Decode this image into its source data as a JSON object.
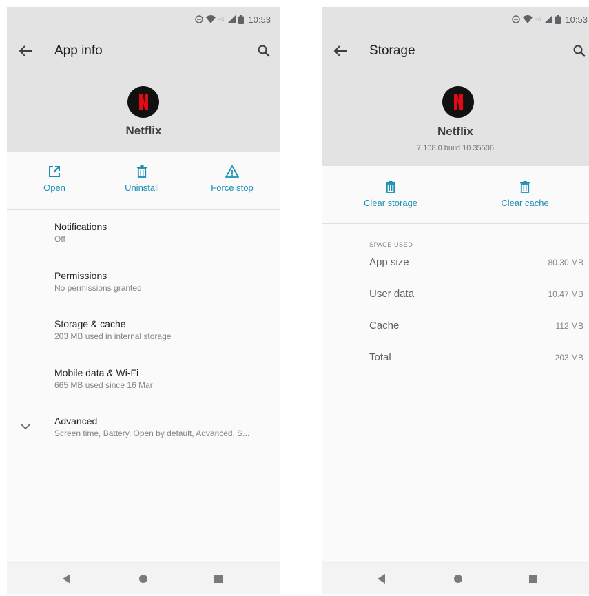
{
  "status_bar": {
    "time": "10:53",
    "icons": [
      "dnd-icon",
      "wifi-icon",
      "4g-icon",
      "signal-icon",
      "battery-icon"
    ]
  },
  "colors": {
    "accent": "#1a8fb4",
    "header_bg": "#e3e3e3",
    "netflix_red": "#e50914"
  },
  "app_info": {
    "title": "App info",
    "app_name": "Netflix",
    "actions": [
      {
        "label": "Open",
        "icon": "open-external-icon"
      },
      {
        "label": "Uninstall",
        "icon": "trash-icon"
      },
      {
        "label": "Force stop",
        "icon": "warning-icon"
      }
    ],
    "items": [
      {
        "title": "Notifications",
        "subtitle": "Off"
      },
      {
        "title": "Permissions",
        "subtitle": "No permissions granted"
      },
      {
        "title": "Storage & cache",
        "subtitle": "203 MB used in internal storage"
      },
      {
        "title": "Mobile data & Wi-Fi",
        "subtitle": "665 MB used since 16 Mar"
      },
      {
        "title": "Advanced",
        "subtitle": "Screen time, Battery, Open by default, Advanced, S..."
      }
    ]
  },
  "storage": {
    "title": "Storage",
    "app_name": "Netflix",
    "version": "7.108.0 build 10 35506",
    "actions": [
      {
        "label": "Clear storage",
        "icon": "trash-icon"
      },
      {
        "label": "Clear cache",
        "icon": "trash-icon"
      }
    ],
    "section_label": "SPACE USED",
    "rows": [
      {
        "label": "App size",
        "value": "80.30 MB"
      },
      {
        "label": "User data",
        "value": "10.47 MB"
      },
      {
        "label": "Cache",
        "value": "112 MB"
      },
      {
        "label": "Total",
        "value": "203 MB"
      }
    ]
  }
}
